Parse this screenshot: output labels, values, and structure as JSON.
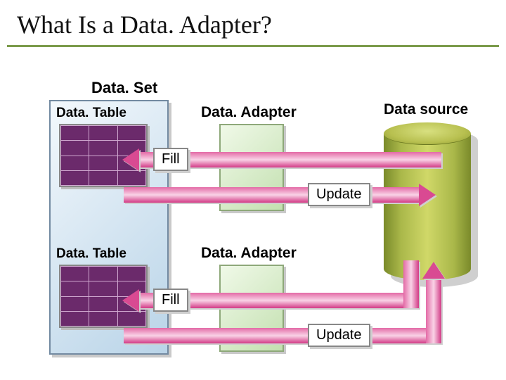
{
  "title": "What Is a Data. Adapter?",
  "dataset": {
    "label": "Data. Set"
  },
  "datatable1": {
    "label": "Data. Table"
  },
  "datatable2": {
    "label": "Data. Table"
  },
  "adapter1": {
    "label": "Data. Adapter"
  },
  "adapter2": {
    "label": "Data. Adapter"
  },
  "datasource": {
    "label": "Data source"
  },
  "flow": {
    "fill1": "Fill",
    "update1": "Update",
    "fill2": "Fill",
    "update2": "Update"
  }
}
